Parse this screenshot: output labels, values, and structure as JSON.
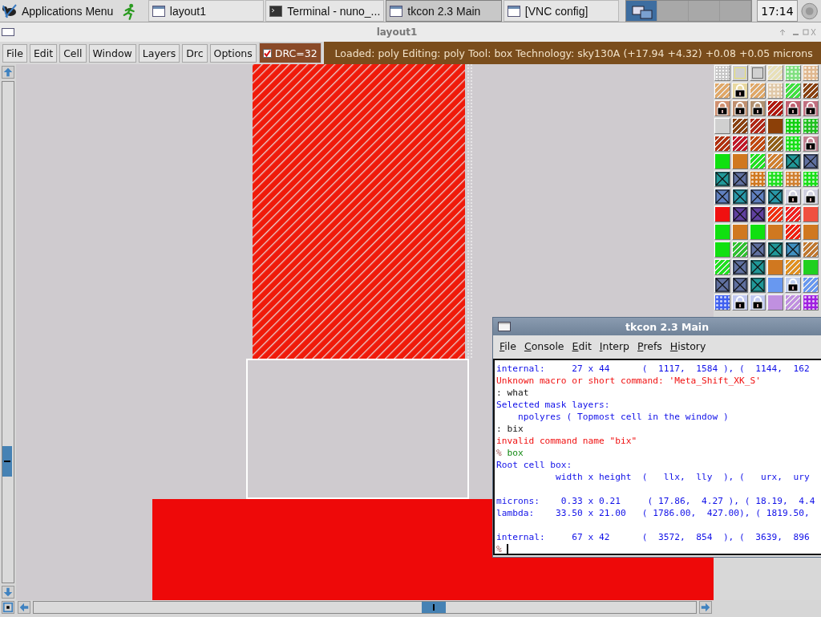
{
  "taskbar": {
    "apps_menu": "Applications Menu",
    "tasks": [
      {
        "label": "layout1",
        "kind": "window",
        "selected": false
      },
      {
        "label": "Terminal - nuno_...",
        "kind": "terminal",
        "selected": false
      },
      {
        "label": "tkcon 2.3 Main",
        "kind": "window",
        "selected": true
      },
      {
        "label": "[VNC config]",
        "kind": "window",
        "selected": false
      }
    ],
    "workspaces": [
      {
        "selected": true
      },
      {
        "selected": false
      },
      {
        "selected": false
      },
      {
        "selected": false
      }
    ],
    "clock": "17:14"
  },
  "layout_window": {
    "title": "layout1",
    "menu": [
      "File",
      "Edit",
      "Cell",
      "Window",
      "Layers",
      "Drc",
      "Options"
    ],
    "drc": {
      "label": "DRC=32",
      "checked": true
    },
    "status": "Loaded: poly Editing: poly Tool: box  Technology: sky130A    (+17.94 +4.32) +0.08 +0.05 microns",
    "layer_palette": [
      [
        {
          "kind": "grid",
          "color": "#c8c8c8"
        },
        {
          "kind": "outline",
          "color": "#e8e070"
        },
        {
          "kind": "outline",
          "color": "#707070"
        },
        {
          "kind": "hatch",
          "color": "#e8e0b8"
        },
        {
          "kind": "dots",
          "color": "#80e080"
        },
        {
          "kind": "dots",
          "color": "#e0b890"
        }
      ],
      [
        {
          "kind": "hatch",
          "color": "#e0a868"
        },
        {
          "kind": "lock",
          "color": "#e8d8a0"
        },
        {
          "kind": "hatch",
          "color": "#e0a868"
        },
        {
          "kind": "dots",
          "color": "#e0c8a8"
        },
        {
          "kind": "hatch",
          "color": "#40e040"
        },
        {
          "kind": "hatch",
          "color": "#884010"
        }
      ],
      [
        {
          "kind": "lock",
          "color": "#d09070"
        },
        {
          "kind": "lock",
          "color": "#c09070"
        },
        {
          "kind": "lock",
          "color": "#b09070"
        },
        {
          "kind": "hatch",
          "color": "#b01810"
        },
        {
          "kind": "lock",
          "color": "#c06070"
        },
        {
          "kind": "lock",
          "color": "#c07080"
        }
      ],
      [
        {
          "kind": "solid",
          "color": "#d0d0d0"
        },
        {
          "kind": "hatch",
          "color": "#884010"
        },
        {
          "kind": "hatch",
          "color": "#b02818"
        },
        {
          "kind": "solid",
          "color": "#8c4008"
        },
        {
          "kind": "dots",
          "color": "#10d010"
        },
        {
          "kind": "dots",
          "color": "#20c020"
        }
      ],
      [
        {
          "kind": "hatch",
          "color": "#b03010"
        },
        {
          "kind": "hatch",
          "color": "#c01828"
        },
        {
          "kind": "hatch",
          "color": "#c04810"
        },
        {
          "kind": "hatch",
          "color": "#906018"
        },
        {
          "kind": "dots",
          "color": "#18e018"
        },
        {
          "kind": "lock",
          "color": "#c08090"
        }
      ],
      [
        {
          "kind": "solid",
          "color": "#10e010"
        },
        {
          "kind": "solid",
          "color": "#d07820"
        },
        {
          "kind": "hatch",
          "color": "#20e020"
        },
        {
          "kind": "hatch",
          "color": "#d08030"
        },
        {
          "kind": "cross",
          "color": "#209898"
        },
        {
          "kind": "cross",
          "color": "#6070a0"
        }
      ],
      [
        {
          "kind": "cross",
          "color": "#209898"
        },
        {
          "kind": "cross",
          "color": "#6070a0"
        },
        {
          "kind": "dots",
          "color": "#d07820"
        },
        {
          "kind": "dots",
          "color": "#20e020"
        },
        {
          "kind": "dots",
          "color": "#d08030"
        },
        {
          "kind": "dots",
          "color": "#18e018"
        }
      ],
      [
        {
          "kind": "cross",
          "color": "#6080c0"
        },
        {
          "kind": "cross",
          "color": "#2898a8"
        },
        {
          "kind": "cross",
          "color": "#6080c0"
        },
        {
          "kind": "cross",
          "color": "#2898a8"
        },
        {
          "kind": "lock",
          "color": "#d0d0e0"
        },
        {
          "kind": "lock",
          "color": "#d0d0e0"
        }
      ],
      [
        {
          "kind": "solid",
          "color": "#f01010"
        },
        {
          "kind": "cross",
          "color": "#6040a0"
        },
        {
          "kind": "cross",
          "color": "#6040a0"
        },
        {
          "kind": "hatch",
          "color": "#f03010"
        },
        {
          "kind": "hatch",
          "color": "#f02020"
        },
        {
          "kind": "solid",
          "color": "#f05040"
        }
      ],
      [
        {
          "kind": "solid",
          "color": "#10e010"
        },
        {
          "kind": "solid",
          "color": "#d07820"
        },
        {
          "kind": "solid",
          "color": "#10e010"
        },
        {
          "kind": "solid",
          "color": "#d07820"
        },
        {
          "kind": "hatch",
          "color": "#f02010"
        },
        {
          "kind": "solid",
          "color": "#d07820"
        }
      ],
      [
        {
          "kind": "solid",
          "color": "#10e010"
        },
        {
          "kind": "hatch",
          "color": "#30c030"
        },
        {
          "kind": "cross",
          "color": "#6070a0"
        },
        {
          "kind": "cross",
          "color": "#209898"
        },
        {
          "kind": "cross",
          "color": "#4090c0"
        },
        {
          "kind": "hatch",
          "color": "#c07830"
        }
      ],
      [
        {
          "kind": "hatch",
          "color": "#20e020"
        },
        {
          "kind": "cross",
          "color": "#6070a0"
        },
        {
          "kind": "cross",
          "color": "#209898"
        },
        {
          "kind": "solid",
          "color": "#d07820"
        },
        {
          "kind": "hatch",
          "color": "#e09020"
        },
        {
          "kind": "solid",
          "color": "#20d020"
        }
      ],
      [
        {
          "kind": "cross",
          "color": "#6070a0"
        },
        {
          "kind": "cross",
          "color": "#6070a0"
        },
        {
          "kind": "cross",
          "color": "#209898"
        },
        {
          "kind": "solid",
          "color": "#6898f0"
        },
        {
          "kind": "lock",
          "color": "#c0d0f0"
        },
        {
          "kind": "hatch",
          "color": "#6898f0"
        }
      ],
      [
        {
          "kind": "dots",
          "color": "#4060f0"
        },
        {
          "kind": "lock",
          "color": "#c0c8f0"
        },
        {
          "kind": "lock",
          "color": "#c0c8f0"
        },
        {
          "kind": "solid",
          "color": "#c090e0"
        },
        {
          "kind": "hatch",
          "color": "#c090e0"
        },
        {
          "kind": "dots",
          "color": "#a020e0"
        }
      ]
    ]
  },
  "console": {
    "title": "tkcon 2.3 Main",
    "menu": [
      "File",
      "Console",
      "Edit",
      "Interp",
      "Prefs",
      "History"
    ],
    "lines": [
      {
        "kind": "info",
        "text": "internal:     27 x 44      (  1117,  1584 ), (  1144,  162"
      },
      {
        "kind": "error",
        "text": "Unknown macro or short command: 'Meta_Shift_XK_S'"
      },
      {
        "kind": "echo",
        "prompt": ":",
        "text": "what"
      },
      {
        "kind": "info",
        "text": "Selected mask layers:"
      },
      {
        "kind": "info",
        "text": "    npolyres ( Topmost cell in the window )"
      },
      {
        "kind": "echo",
        "prompt": ":",
        "text": "bix"
      },
      {
        "kind": "error",
        "text": "invalid command name \"bix\""
      },
      {
        "kind": "command",
        "prompt": "%",
        "text": "box"
      },
      {
        "kind": "info",
        "text": "Root cell box:"
      },
      {
        "kind": "info",
        "text": "           width x height  (   llx,  lly  ), (   urx,  ury"
      },
      {
        "kind": "blank"
      },
      {
        "kind": "info",
        "text": "microns:    0.33 x 0.21     ( 17.86,  4.27 ), ( 18.19,  4.4"
      },
      {
        "kind": "info",
        "text": "lambda:    33.50 x 21.00   ( 1786.00,  427.00), ( 1819.50,"
      },
      {
        "kind": "blank"
      },
      {
        "kind": "info",
        "text": "internal:     67 x 42      (  3572,  854  ), (  3639,  896"
      },
      {
        "kind": "cursor",
        "prompt": "%"
      }
    ]
  }
}
